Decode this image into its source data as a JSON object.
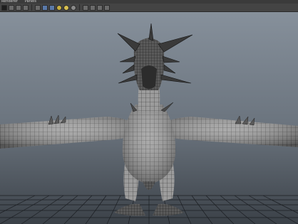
{
  "menu": [
    "Renderer",
    "Panels"
  ],
  "colors": {
    "viewport_top": "#7f8994",
    "viewport_bottom": "#3d434a",
    "grid": "#1a1d21",
    "mesh_light": "#b8b8b8",
    "mesh_dark": "#4a4a4a"
  },
  "toolbar": {
    "buttons": [
      "camera-icon",
      "select-camera-icon",
      "frame-all-icon",
      "frame-selected-icon",
      "wireframe-icon",
      "smooth-shade-icon",
      "textured-icon",
      "lights-icon",
      "shadows-icon",
      "xray-icon",
      "isolate-icon",
      "grid-icon",
      "resolution-gate-icon",
      "film-gate-icon"
    ]
  },
  "scene": {
    "model": "dragon-wireframe-mesh"
  }
}
